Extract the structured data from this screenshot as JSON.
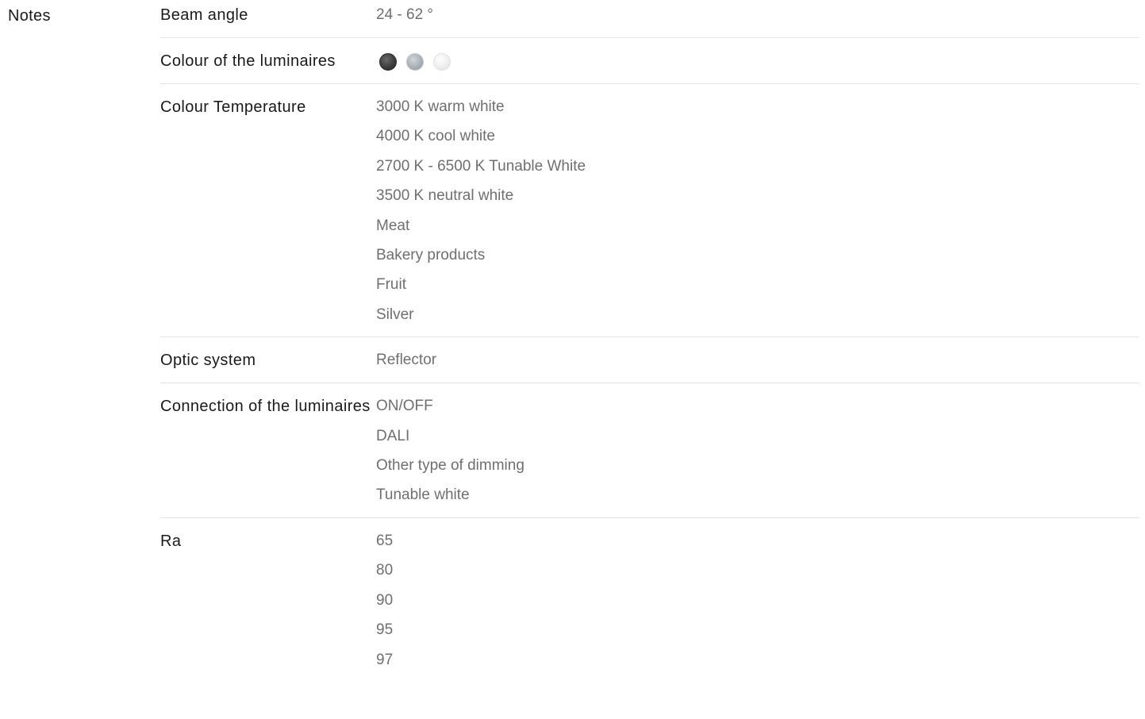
{
  "section": {
    "label": "Notes"
  },
  "specs": [
    {
      "label": "Beam angle",
      "values": [
        "24 - 62 °"
      ]
    },
    {
      "label": "Colour of the luminaires",
      "swatches": [
        {
          "name": "dark-grey",
          "color": "#3d3d3d"
        },
        {
          "name": "silver-grey",
          "color": "#a9b0b6"
        },
        {
          "name": "white",
          "color": "#eeeeee"
        }
      ]
    },
    {
      "label": "Colour Temperature",
      "values": [
        "3000 K warm white",
        "4000 K cool white",
        "2700 K - 6500 K Tunable White",
        "3500 K neutral white",
        "Meat",
        "Bakery products",
        "Fruit",
        "Silver"
      ]
    },
    {
      "label": "Optic system",
      "values": [
        "Reflector"
      ]
    },
    {
      "label": "Connection of the luminaires",
      "values": [
        "ON/OFF",
        "DALI",
        "Other type of dimming",
        "Tunable white"
      ]
    },
    {
      "label": "Ra",
      "values": [
        "65",
        "80",
        "90",
        "95",
        "97"
      ]
    }
  ]
}
